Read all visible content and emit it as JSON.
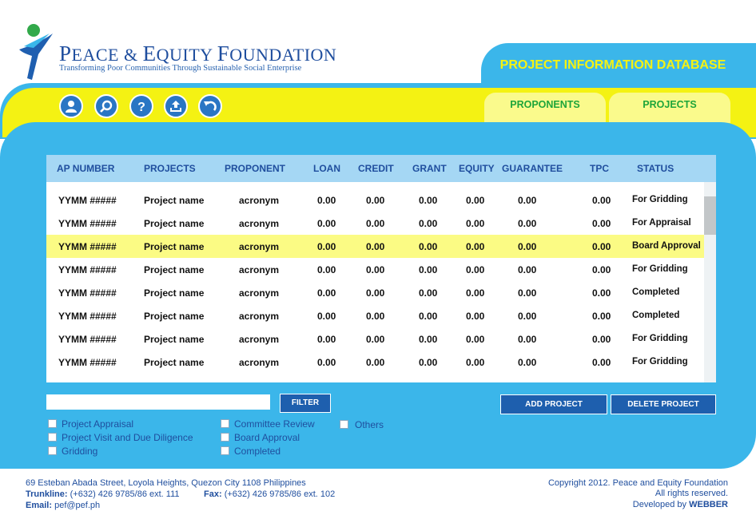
{
  "brand": {
    "title_caps_1": "P",
    "title_rest_1": "EACE & ",
    "title_caps_2": "E",
    "title_rest_2": "QUITY ",
    "title_caps_3": "F",
    "title_rest_3": "OUNDATION",
    "tagline": "Transforming Poor Communities Through Sustainable Social Enterprise"
  },
  "header": {
    "db_title": "PROJECT INFORMATION DATABASE"
  },
  "toolbar": {
    "icons": [
      "user-icon",
      "search-icon",
      "help-icon",
      "upload-icon",
      "back-icon"
    ]
  },
  "tabs": [
    {
      "label": "PROPONENTS"
    },
    {
      "label": "PROJECTS"
    }
  ],
  "table": {
    "columns": [
      "AP NUMBER",
      "PROJECTS",
      "PROPONENT",
      "LOAN",
      "CREDIT",
      "GRANT",
      "EQUITY",
      "GUARANTEE",
      "TPC",
      "STATUS"
    ],
    "rows": [
      {
        "ap": "YYMM #####",
        "project": "Project name",
        "proponent": "acronym",
        "loan": "0.00",
        "credit": "0.00",
        "grant": "0.00",
        "equity": "0.00",
        "guarantee": "0.00",
        "tpc": "0.00",
        "status": "For Gridding"
      },
      {
        "ap": "YYMM #####",
        "project": "Project name",
        "proponent": "acronym",
        "loan": "0.00",
        "credit": "0.00",
        "grant": "0.00",
        "equity": "0.00",
        "guarantee": "0.00",
        "tpc": "0.00",
        "status": "For Appraisal"
      },
      {
        "ap": "YYMM #####",
        "project": "Project name",
        "proponent": "acronym",
        "loan": "0.00",
        "credit": "0.00",
        "grant": "0.00",
        "equity": "0.00",
        "guarantee": "0.00",
        "tpc": "0.00",
        "status": "Board Approval"
      },
      {
        "ap": "YYMM #####",
        "project": "Project name",
        "proponent": "acronym",
        "loan": "0.00",
        "credit": "0.00",
        "grant": "0.00",
        "equity": "0.00",
        "guarantee": "0.00",
        "tpc": "0.00",
        "status": "For Gridding"
      },
      {
        "ap": "YYMM #####",
        "project": "Project name",
        "proponent": "acronym",
        "loan": "0.00",
        "credit": "0.00",
        "grant": "0.00",
        "equity": "0.00",
        "guarantee": "0.00",
        "tpc": "0.00",
        "status": "Completed"
      },
      {
        "ap": "YYMM #####",
        "project": "Project name",
        "proponent": "acronym",
        "loan": "0.00",
        "credit": "0.00",
        "grant": "0.00",
        "equity": "0.00",
        "guarantee": "0.00",
        "tpc": "0.00",
        "status": "Completed"
      },
      {
        "ap": "YYMM #####",
        "project": "Project name",
        "proponent": "acronym",
        "loan": "0.00",
        "credit": "0.00",
        "grant": "0.00",
        "equity": "0.00",
        "guarantee": "0.00",
        "tpc": "0.00",
        "status": "For Gridding"
      },
      {
        "ap": "YYMM #####",
        "project": "Project name",
        "proponent": "acronym",
        "loan": "0.00",
        "credit": "0.00",
        "grant": "0.00",
        "equity": "0.00",
        "guarantee": "0.00",
        "tpc": "0.00",
        "status": "For Gridding"
      }
    ],
    "selected_row": 3
  },
  "filter": {
    "input_value": "",
    "button_label": "FILTER"
  },
  "actions": {
    "add_label": "ADD PROJECT",
    "delete_label": "DELETE PROJECT"
  },
  "checkboxes": [
    {
      "label": "Project Appraisal",
      "checked": false
    },
    {
      "label": "Project Visit and Due Diligence",
      "checked": false
    },
    {
      "label": "Gridding",
      "checked": false
    },
    {
      "label": "Committee Review",
      "checked": false
    },
    {
      "label": "Board Approval",
      "checked": false
    },
    {
      "label": "Completed",
      "checked": false
    },
    {
      "label": "Others",
      "checked": false
    }
  ],
  "footer": {
    "address": "69 Esteban Abada Street, Loyola Heights, Quezon City 1108 Philippines",
    "trunkline_label": "Trunkline:",
    "trunkline": "(+632) 426 9785/86 ext. 111",
    "fax_label": "Fax:",
    "fax": "(+632) 426 9785/86 ext. 102",
    "email_label": "Email:",
    "email": "pef@pef.ph",
    "copyright": "Copyright 2012. Peace and Equity Foundation",
    "rights": "All rights reserved.",
    "developed_label": "Developed by",
    "developer": "WEBBER"
  },
  "colors": {
    "panel_blue": "#3bb6ea",
    "band_yellow": "#f4f213",
    "title_yellow": "#f5f212",
    "tab_green": "#1ea53a",
    "button_blue": "#1e5fae",
    "text_blue": "#1f4e9e",
    "selected_row": "#fbfb84"
  }
}
